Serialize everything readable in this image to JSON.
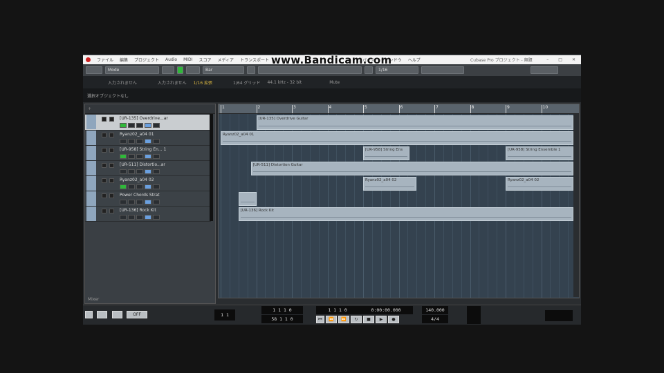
{
  "titlebar": {
    "menus": [
      "ファイル",
      "編集",
      "プロジェクト",
      "Audio",
      "MIDI",
      "スコア",
      "メディア",
      "トランスポート",
      "デバイス",
      "ウィンドウ",
      "ヘルプ"
    ],
    "window_title": "Cubase Pro プロジェクト - 無題"
  },
  "watermark": "www.Bandicam.com",
  "toolbar": {
    "automation": "Mode",
    "snap": "Bar",
    "quantize": "1/16"
  },
  "infoline": {
    "items": [
      "入力されません",
      "入力されません",
      "1/16 拡張",
      "1/64 グリッド",
      "44.1 kHz - 32 bit",
      "Mute"
    ]
  },
  "statusline": "選択オブジェクトなし",
  "tracklist": {
    "footer": "Mixer",
    "tracks": [
      {
        "name": "[UR-135] Overdrive...ar",
        "selected": true
      },
      {
        "name": "Ryanz02_a04 01"
      },
      {
        "name": "[UR-958] String En... 1"
      },
      {
        "name": "[UR-511] Distortio...ar"
      },
      {
        "name": "Ryanz02_a04 02"
      },
      {
        "name": "Power Chords Strat"
      },
      {
        "name": "[UR-136] Rock Kit"
      }
    ]
  },
  "ruler": [
    "1",
    "2",
    "3",
    "4",
    "5",
    "6",
    "7",
    "8",
    "9",
    "10"
  ],
  "events": [
    {
      "name": "[UR-135] Overdrive Guitar",
      "track": 0,
      "start_bar": 2.0,
      "end_bar": 10.9
    },
    {
      "name": "Ryanz02_a04 01",
      "track": 1,
      "start_bar": 1.0,
      "end_bar": 10.9
    },
    {
      "name": "[UR-958] String Ens",
      "track": 2,
      "start_bar": 5.0,
      "end_bar": 6.3
    },
    {
      "name": "[UR-958] String Ensemble 1",
      "track": 2,
      "start_bar": 9.0,
      "end_bar": 10.9
    },
    {
      "name": "[UR-511] Distortion Guitar",
      "track": 3,
      "start_bar": 1.85,
      "end_bar": 10.9
    },
    {
      "name": "Ryanz02_a04 02",
      "track": 4,
      "start_bar": 5.0,
      "end_bar": 6.5
    },
    {
      "name": "Ryanz02_a04 02",
      "track": 4,
      "start_bar": 9.0,
      "end_bar": 10.9
    },
    {
      "name": "",
      "track": 5,
      "start_bar": 1.5,
      "end_bar": 2.0
    },
    {
      "name": "[UR-136] Rock Kit",
      "track": 6,
      "start_bar": 1.5,
      "end_bar": 10.9
    }
  ],
  "transport": {
    "left_locator": "1 1 1 0",
    "right_locator": "58 1 1 0",
    "position_bars": "1 1 1 0",
    "position_time": "0:00:00.000",
    "tempo": "140.000",
    "signature": "4/4",
    "counter": "1 1",
    "punch": "OFF"
  },
  "colors": {
    "accent_green": "#2fb83a",
    "event": "#a7b4bf",
    "arrange_bg": "#34424f"
  }
}
